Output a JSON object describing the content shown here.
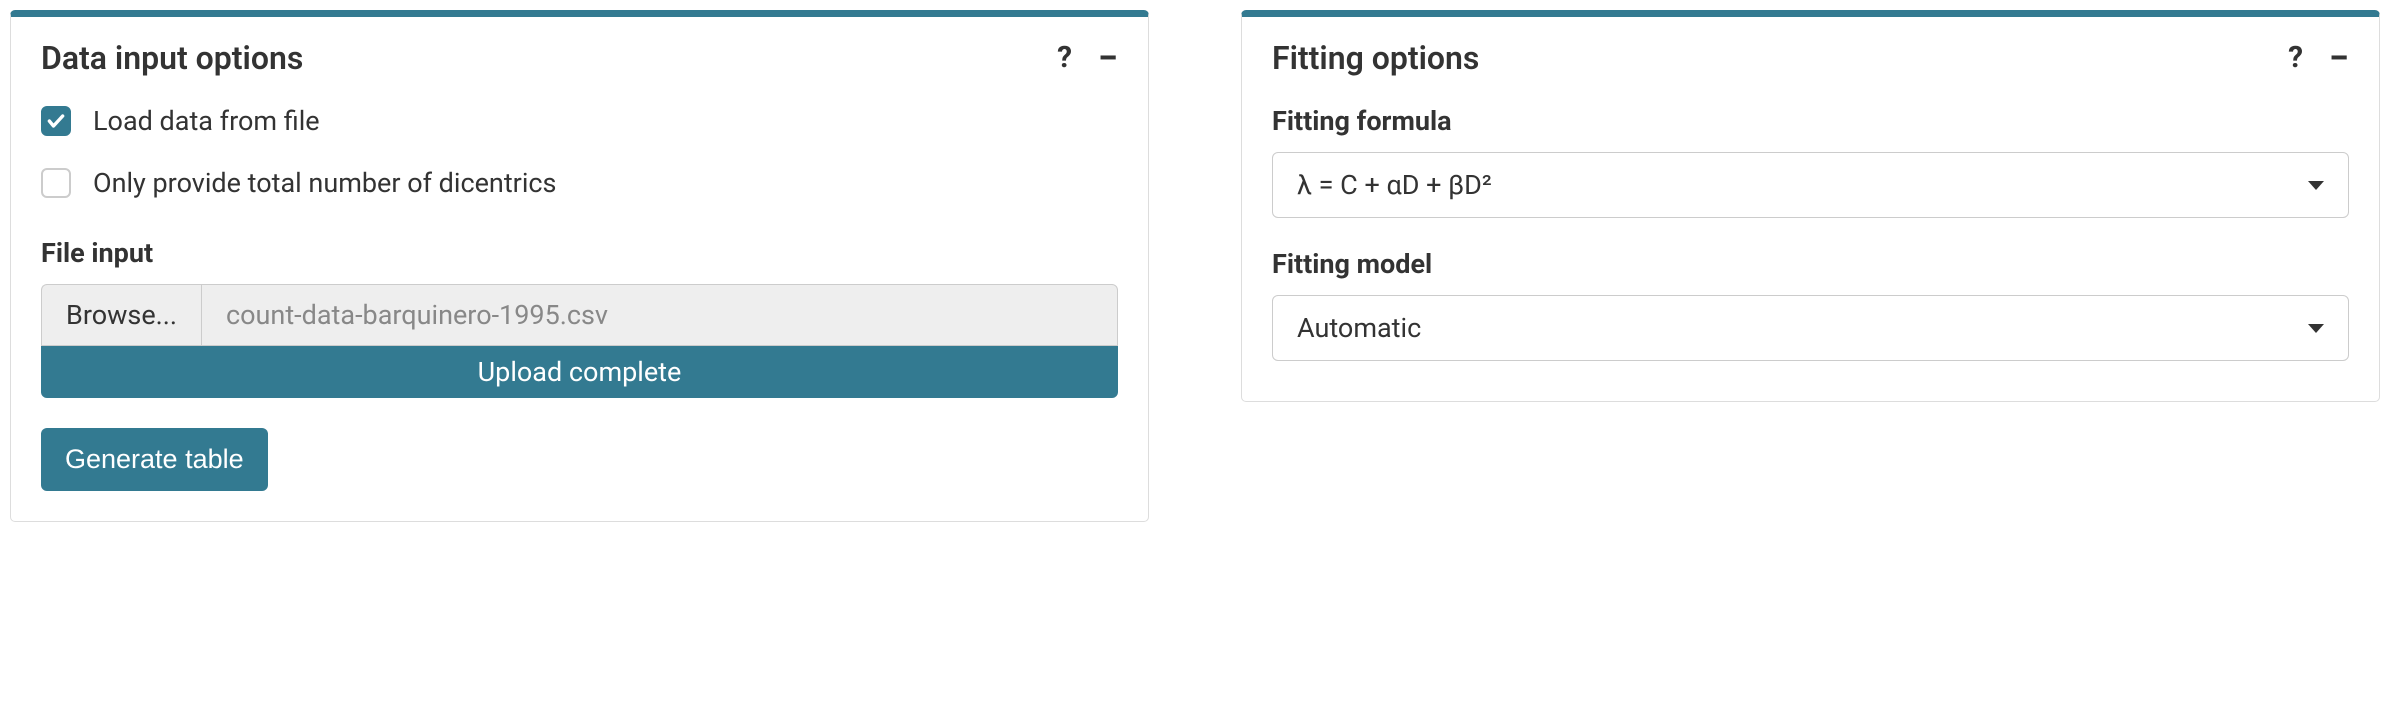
{
  "dataInput": {
    "title": "Data input options",
    "loadFromFile": {
      "label": "Load data from file",
      "checked": true
    },
    "onlyTotal": {
      "label": "Only provide total number of dicentrics",
      "checked": false
    },
    "fileInputLabel": "File input",
    "browseLabel": "Browse...",
    "fileName": "count-data-barquinero-1995.csv",
    "uploadStatus": "Upload complete",
    "generateButton": "Generate table"
  },
  "fitting": {
    "title": "Fitting options",
    "formulaLabel": "Fitting formula",
    "formulaValue": "λ = C + αD + βD²",
    "modelLabel": "Fitting model",
    "modelValue": "Automatic"
  }
}
